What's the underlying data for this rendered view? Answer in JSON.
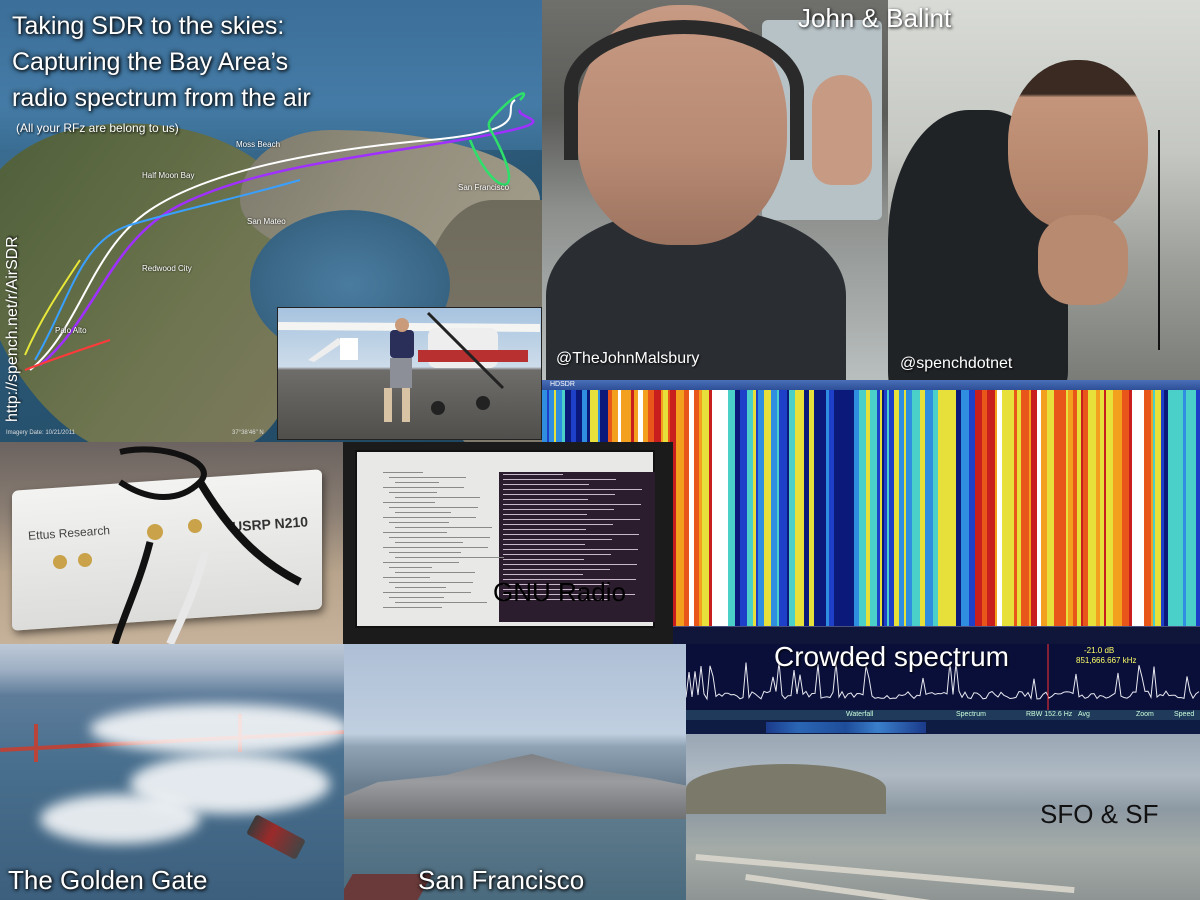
{
  "map": {
    "title_lines": [
      "Taking SDR to the skies:",
      "Capturing the Bay Area’s",
      "radio spectrum from the air"
    ],
    "subtitle": "(All your RFz are belong to us)",
    "url": "http://spench.net/r/AirSDR",
    "imagery_date": "Imagery Date: 10/21/2011",
    "coords": "37°38'46\" N",
    "places": [
      "Moss Beach",
      "Half Moon Bay",
      "San Mateo",
      "Redwood City",
      "Palo Alto",
      "San Francisco"
    ],
    "track_colors": [
      "#ffffff",
      "#a030ff",
      "#3aa0ff",
      "#2ee06a",
      "#e8e83a",
      "#ff3a3a"
    ]
  },
  "photos": {
    "names": "John & Balint",
    "john_handle": "@TheJohnMalsbury",
    "balint_handle": "@spenchdotnet",
    "usrp_brand": "Ettus Research",
    "usrp_model": "USRP N210",
    "gnu_radio": "GNU Radio",
    "golden_gate": "The Golden Gate",
    "san_francisco": "San Francisco",
    "sfo_sf": "SFO & SF"
  },
  "spectrum": {
    "window_title": "HDSDR",
    "label": "Crowded spectrum",
    "level": "-21.0 dB",
    "frequency": "851,666.667 kHz",
    "toolbar": {
      "waterfall": "Waterfall",
      "spectrum": "Spectrum",
      "rbw": "RBW 152.6 Hz",
      "avg": "Avg",
      "zoom": "Zoom",
      "speed": "Speed"
    }
  },
  "colors": {
    "waterfall_palette": [
      "#0b1a7a",
      "#1e3fc8",
      "#2f8ee0",
      "#4ad0c8",
      "#e8e03a",
      "#f2a01e",
      "#e8561a",
      "#c81e1e",
      "#ffffff"
    ]
  }
}
